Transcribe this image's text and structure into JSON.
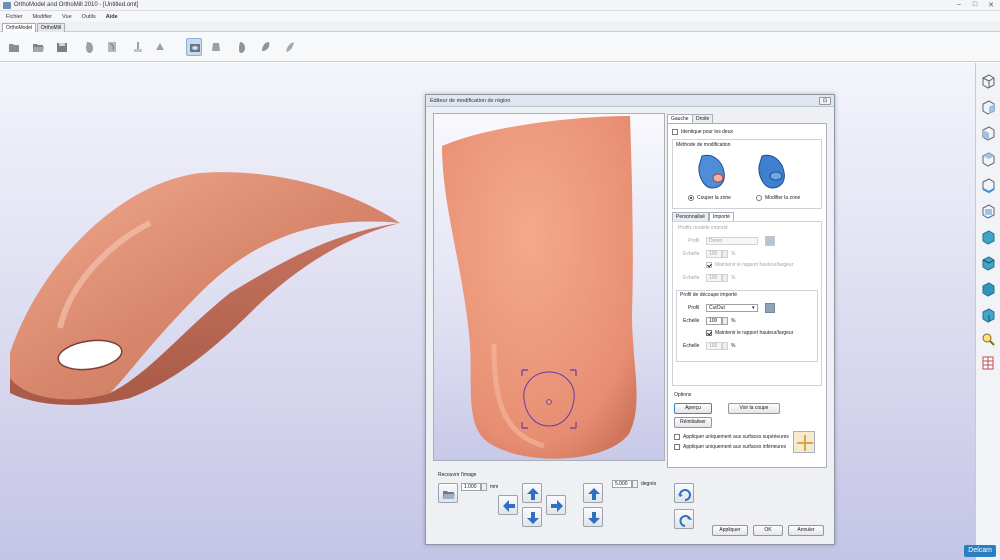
{
  "window": {
    "title": "OrthoModel and OrthoMill 2010 - [Untitled.omt]",
    "min": "–",
    "max": "□",
    "close": "✕"
  },
  "menu": [
    "Fichier",
    "Modifier",
    "Vue",
    "Outils",
    "Aide"
  ],
  "tabs": [
    "OrthoModel",
    "OrthoMill"
  ],
  "toolbar_icons": [
    "folder-new-icon",
    "folder-open-icon",
    "save-icon",
    "insole-top-icon",
    "insole-page-icon",
    "insole-bar-icon",
    "insole-lift-icon",
    "insole-region-icon",
    "insole-heel-icon",
    "insole-shape-icon",
    "insole-sole-icon"
  ],
  "right_toolbar_icons": [
    "view-cube-1-icon",
    "view-cube-2-icon",
    "view-cube-3-icon",
    "view-cube-4-icon",
    "view-cube-5-icon",
    "view-cube-6-icon",
    "view-cube-7-icon",
    "view-cube-8-icon",
    "view-cube-9-icon",
    "view-cube-10-icon",
    "zoom-icon",
    "grid-icon"
  ],
  "dialog": {
    "title": "Editeur de modification de région",
    "close": "⊡",
    "tabs": [
      "Gauche",
      "Droite"
    ],
    "identical_label": "Identique pour les deux",
    "method_group": "Méthode de modification",
    "radio_cut": "Couper la zone",
    "radio_modify": "Modifier la zone",
    "subtabs": [
      "Personnalisé",
      "Importé"
    ],
    "imported_model_title": "Profils modèle importé",
    "profile_label": "Profil",
    "profile_value": "Demo",
    "scale_label": "Echelle",
    "scale_value": "100",
    "percent": "%",
    "keep_ratio": "Maintenir le rapport hauteur/largeur",
    "scale2_value": "100",
    "cut_profile_title": "Profil de découpe importé",
    "cut_profile_value": "CutOut",
    "cut_scale_value": "100",
    "cut_keep_ratio": "Maintenir le rapport hauteur/largeur",
    "cut_scale2_value": "100",
    "options_title": "Options",
    "btn_preview": "Aperçu",
    "btn_view_cut": "Voir la coupe",
    "btn_reset": "Réinitialiser",
    "apply_top": "Appliquer uniquement aux surfaces supérieures",
    "apply_bottom": "Appliquer uniquement aux surfaces inférieures",
    "recover_title": "Recouvrir l'image",
    "step_value": "1.000",
    "step_unit": "mm",
    "angle_value": "5.000",
    "angle_unit": "degrés",
    "btn_apply": "Appliquer",
    "btn_ok": "OK",
    "btn_cancel": "Annuler"
  },
  "brand": "Delcam",
  "colors": {
    "insole": "#e8967a",
    "accent": "#2a7fc1",
    "selection": "#6a3aa8"
  }
}
